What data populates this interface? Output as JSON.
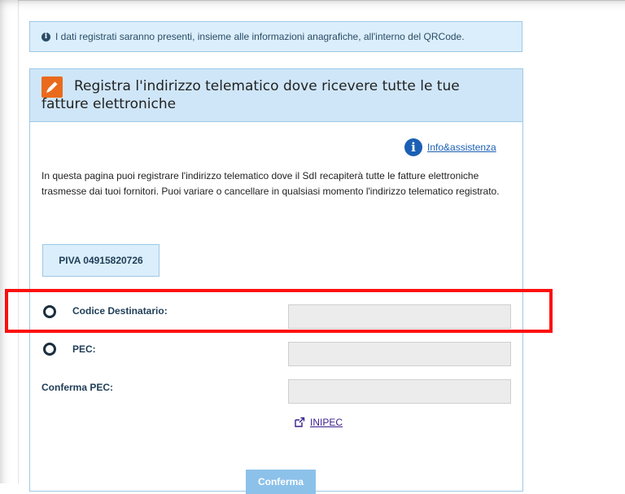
{
  "info_bar": {
    "icon": "info-dot-icon",
    "text": "I dati registrati saranno presenti, insieme alle informazioni anagrafiche, all'interno del QRCode."
  },
  "panel": {
    "title": "Registra l'indirizzo telematico dove ricevere tutte le tue fatture elettroniche",
    "title_icon": "pencil-icon",
    "accent_color": "#ea6a1d",
    "header_bg": "#cfe6f8"
  },
  "help": {
    "icon": "info-circle-icon",
    "link_label": "Info&assistenza"
  },
  "description": "In questa pagina puoi registrare l'indirizzo telematico dove il SdI recapiterà tutte le fatture elettroniche trasmesse dai tuoi fornitori. Puoi variare o cancellare in qualsiasi momento l'indirizzo telematico registrato.",
  "piva": "PIVA 04915820726",
  "form": {
    "codice_label": "Codice Destinatario:",
    "codice_value": "",
    "pec_label": "PEC:",
    "pec_value": "",
    "conferma_pec_label": "Conferma PEC:",
    "conferma_pec_value": ""
  },
  "inipec": {
    "icon": "external-link-icon",
    "label": "INIPEC"
  },
  "confirm_button": "Conferma",
  "annotation": {
    "color": "#ff1010"
  }
}
